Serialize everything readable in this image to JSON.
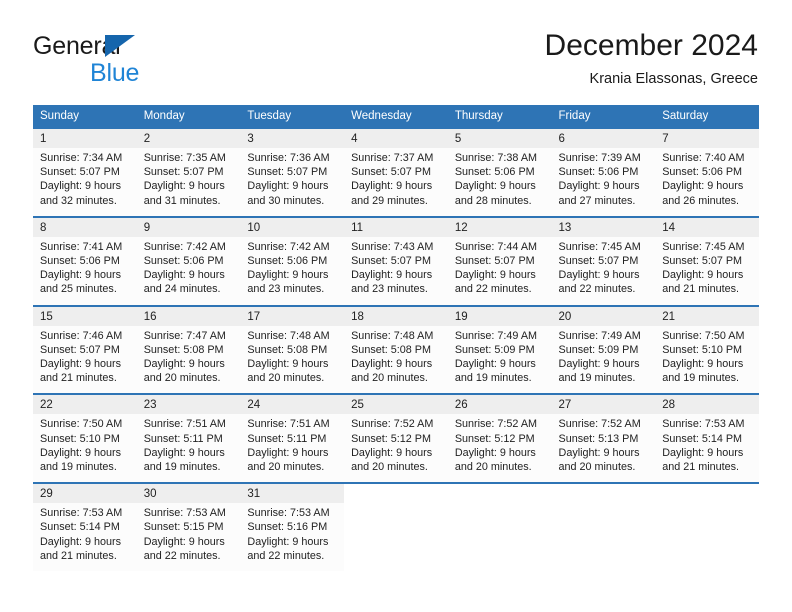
{
  "brand": {
    "name_part1": "General",
    "name_part2": "Blue",
    "logo_icon": "triangle-logo-icon"
  },
  "header": {
    "title": "December 2024",
    "subtitle": "Krania Elassonas, Greece"
  },
  "calendar": {
    "weekday_headers": [
      "Sunday",
      "Monday",
      "Tuesday",
      "Wednesday",
      "Thursday",
      "Friday",
      "Saturday"
    ],
    "accent_color": "#2e74b5",
    "daynum_band_color": "#eeeeee",
    "weeks": [
      {
        "days": [
          {
            "num": "1",
            "sunrise": "Sunrise: 7:34 AM",
            "sunset": "Sunset: 5:07 PM",
            "daylight_l1": "Daylight: 9 hours",
            "daylight_l2": "and 32 minutes."
          },
          {
            "num": "2",
            "sunrise": "Sunrise: 7:35 AM",
            "sunset": "Sunset: 5:07 PM",
            "daylight_l1": "Daylight: 9 hours",
            "daylight_l2": "and 31 minutes."
          },
          {
            "num": "3",
            "sunrise": "Sunrise: 7:36 AM",
            "sunset": "Sunset: 5:07 PM",
            "daylight_l1": "Daylight: 9 hours",
            "daylight_l2": "and 30 minutes."
          },
          {
            "num": "4",
            "sunrise": "Sunrise: 7:37 AM",
            "sunset": "Sunset: 5:07 PM",
            "daylight_l1": "Daylight: 9 hours",
            "daylight_l2": "and 29 minutes."
          },
          {
            "num": "5",
            "sunrise": "Sunrise: 7:38 AM",
            "sunset": "Sunset: 5:06 PM",
            "daylight_l1": "Daylight: 9 hours",
            "daylight_l2": "and 28 minutes."
          },
          {
            "num": "6",
            "sunrise": "Sunrise: 7:39 AM",
            "sunset": "Sunset: 5:06 PM",
            "daylight_l1": "Daylight: 9 hours",
            "daylight_l2": "and 27 minutes."
          },
          {
            "num": "7",
            "sunrise": "Sunrise: 7:40 AM",
            "sunset": "Sunset: 5:06 PM",
            "daylight_l1": "Daylight: 9 hours",
            "daylight_l2": "and 26 minutes."
          }
        ]
      },
      {
        "days": [
          {
            "num": "8",
            "sunrise": "Sunrise: 7:41 AM",
            "sunset": "Sunset: 5:06 PM",
            "daylight_l1": "Daylight: 9 hours",
            "daylight_l2": "and 25 minutes."
          },
          {
            "num": "9",
            "sunrise": "Sunrise: 7:42 AM",
            "sunset": "Sunset: 5:06 PM",
            "daylight_l1": "Daylight: 9 hours",
            "daylight_l2": "and 24 minutes."
          },
          {
            "num": "10",
            "sunrise": "Sunrise: 7:42 AM",
            "sunset": "Sunset: 5:06 PM",
            "daylight_l1": "Daylight: 9 hours",
            "daylight_l2": "and 23 minutes."
          },
          {
            "num": "11",
            "sunrise": "Sunrise: 7:43 AM",
            "sunset": "Sunset: 5:07 PM",
            "daylight_l1": "Daylight: 9 hours",
            "daylight_l2": "and 23 minutes."
          },
          {
            "num": "12",
            "sunrise": "Sunrise: 7:44 AM",
            "sunset": "Sunset: 5:07 PM",
            "daylight_l1": "Daylight: 9 hours",
            "daylight_l2": "and 22 minutes."
          },
          {
            "num": "13",
            "sunrise": "Sunrise: 7:45 AM",
            "sunset": "Sunset: 5:07 PM",
            "daylight_l1": "Daylight: 9 hours",
            "daylight_l2": "and 22 minutes."
          },
          {
            "num": "14",
            "sunrise": "Sunrise: 7:45 AM",
            "sunset": "Sunset: 5:07 PM",
            "daylight_l1": "Daylight: 9 hours",
            "daylight_l2": "and 21 minutes."
          }
        ]
      },
      {
        "days": [
          {
            "num": "15",
            "sunrise": "Sunrise: 7:46 AM",
            "sunset": "Sunset: 5:07 PM",
            "daylight_l1": "Daylight: 9 hours",
            "daylight_l2": "and 21 minutes."
          },
          {
            "num": "16",
            "sunrise": "Sunrise: 7:47 AM",
            "sunset": "Sunset: 5:08 PM",
            "daylight_l1": "Daylight: 9 hours",
            "daylight_l2": "and 20 minutes."
          },
          {
            "num": "17",
            "sunrise": "Sunrise: 7:48 AM",
            "sunset": "Sunset: 5:08 PM",
            "daylight_l1": "Daylight: 9 hours",
            "daylight_l2": "and 20 minutes."
          },
          {
            "num": "18",
            "sunrise": "Sunrise: 7:48 AM",
            "sunset": "Sunset: 5:08 PM",
            "daylight_l1": "Daylight: 9 hours",
            "daylight_l2": "and 20 minutes."
          },
          {
            "num": "19",
            "sunrise": "Sunrise: 7:49 AM",
            "sunset": "Sunset: 5:09 PM",
            "daylight_l1": "Daylight: 9 hours",
            "daylight_l2": "and 19 minutes."
          },
          {
            "num": "20",
            "sunrise": "Sunrise: 7:49 AM",
            "sunset": "Sunset: 5:09 PM",
            "daylight_l1": "Daylight: 9 hours",
            "daylight_l2": "and 19 minutes."
          },
          {
            "num": "21",
            "sunrise": "Sunrise: 7:50 AM",
            "sunset": "Sunset: 5:10 PM",
            "daylight_l1": "Daylight: 9 hours",
            "daylight_l2": "and 19 minutes."
          }
        ]
      },
      {
        "days": [
          {
            "num": "22",
            "sunrise": "Sunrise: 7:50 AM",
            "sunset": "Sunset: 5:10 PM",
            "daylight_l1": "Daylight: 9 hours",
            "daylight_l2": "and 19 minutes."
          },
          {
            "num": "23",
            "sunrise": "Sunrise: 7:51 AM",
            "sunset": "Sunset: 5:11 PM",
            "daylight_l1": "Daylight: 9 hours",
            "daylight_l2": "and 19 minutes."
          },
          {
            "num": "24",
            "sunrise": "Sunrise: 7:51 AM",
            "sunset": "Sunset: 5:11 PM",
            "daylight_l1": "Daylight: 9 hours",
            "daylight_l2": "and 20 minutes."
          },
          {
            "num": "25",
            "sunrise": "Sunrise: 7:52 AM",
            "sunset": "Sunset: 5:12 PM",
            "daylight_l1": "Daylight: 9 hours",
            "daylight_l2": "and 20 minutes."
          },
          {
            "num": "26",
            "sunrise": "Sunrise: 7:52 AM",
            "sunset": "Sunset: 5:12 PM",
            "daylight_l1": "Daylight: 9 hours",
            "daylight_l2": "and 20 minutes."
          },
          {
            "num": "27",
            "sunrise": "Sunrise: 7:52 AM",
            "sunset": "Sunset: 5:13 PM",
            "daylight_l1": "Daylight: 9 hours",
            "daylight_l2": "and 20 minutes."
          },
          {
            "num": "28",
            "sunrise": "Sunrise: 7:53 AM",
            "sunset": "Sunset: 5:14 PM",
            "daylight_l1": "Daylight: 9 hours",
            "daylight_l2": "and 21 minutes."
          }
        ]
      },
      {
        "days": [
          {
            "num": "29",
            "sunrise": "Sunrise: 7:53 AM",
            "sunset": "Sunset: 5:14 PM",
            "daylight_l1": "Daylight: 9 hours",
            "daylight_l2": "and 21 minutes."
          },
          {
            "num": "30",
            "sunrise": "Sunrise: 7:53 AM",
            "sunset": "Sunset: 5:15 PM",
            "daylight_l1": "Daylight: 9 hours",
            "daylight_l2": "and 22 minutes."
          },
          {
            "num": "31",
            "sunrise": "Sunrise: 7:53 AM",
            "sunset": "Sunset: 5:16 PM",
            "daylight_l1": "Daylight: 9 hours",
            "daylight_l2": "and 22 minutes."
          },
          {
            "num": "",
            "sunrise": "",
            "sunset": "",
            "daylight_l1": "",
            "daylight_l2": ""
          },
          {
            "num": "",
            "sunrise": "",
            "sunset": "",
            "daylight_l1": "",
            "daylight_l2": ""
          },
          {
            "num": "",
            "sunrise": "",
            "sunset": "",
            "daylight_l1": "",
            "daylight_l2": ""
          },
          {
            "num": "",
            "sunrise": "",
            "sunset": "",
            "daylight_l1": "",
            "daylight_l2": ""
          }
        ]
      }
    ]
  }
}
